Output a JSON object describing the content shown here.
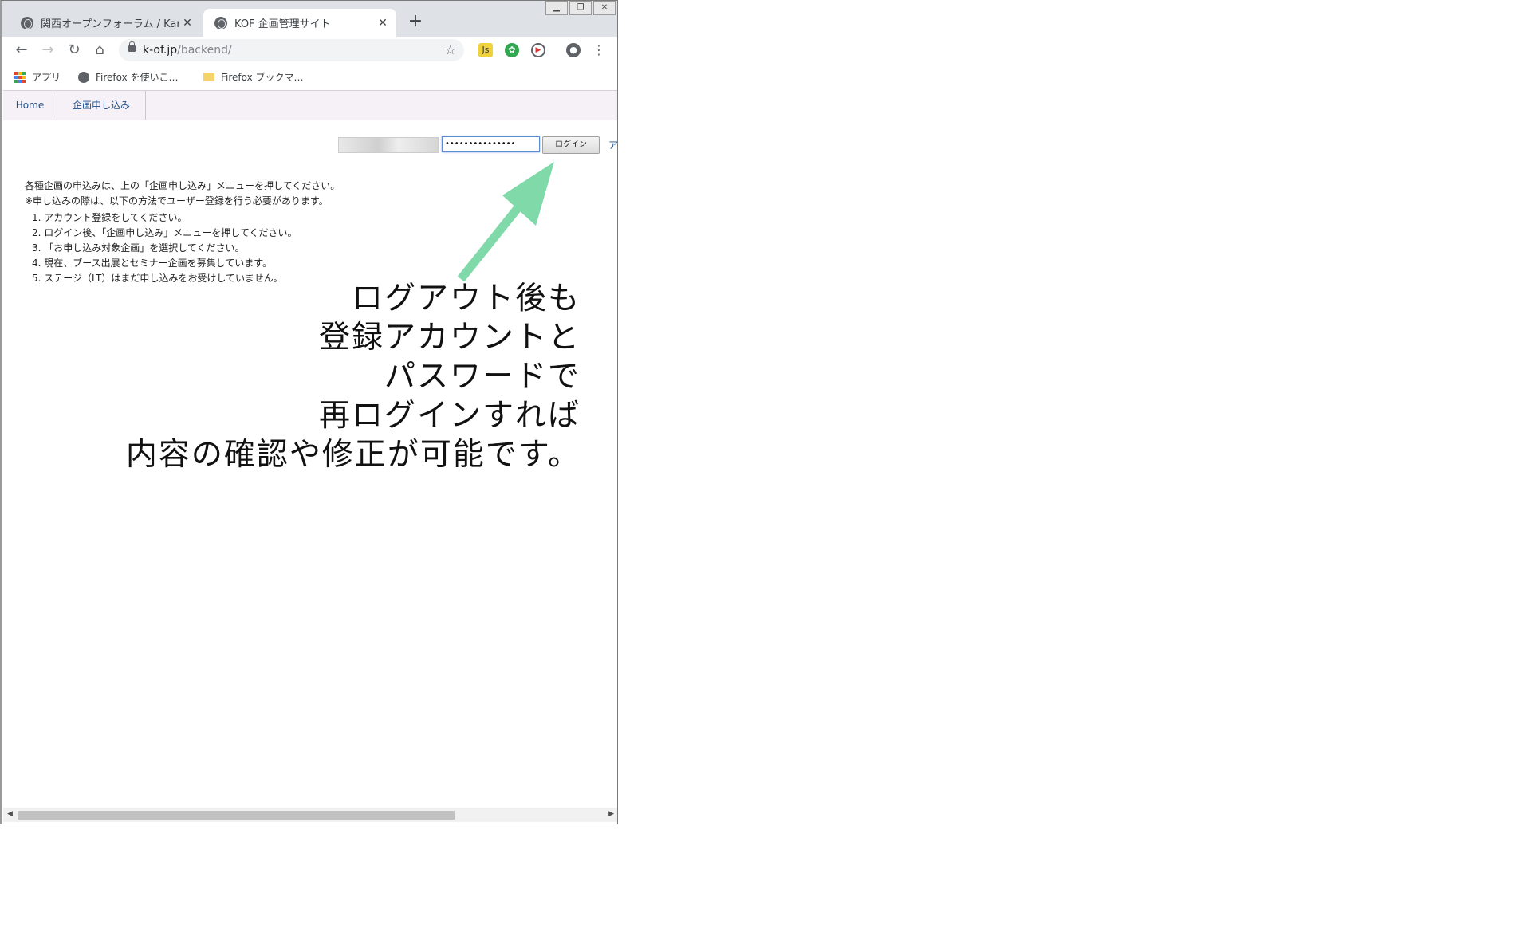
{
  "browser": {
    "tabs": [
      {
        "title": "関西オープンフォーラム / Kansa",
        "active": false
      },
      {
        "title": "KOF 企画管理サイト",
        "active": true
      }
    ],
    "new_tab_symbol": "+",
    "window_controls": [
      "minimize",
      "restore",
      "close"
    ],
    "url_host": "k-of.jp",
    "url_path": "/backend/",
    "bookmarks": [
      {
        "label": "アプリ",
        "icon": "apps-grid-icon"
      },
      {
        "label": "Firefox を使いこ…",
        "icon": "globe-icon"
      },
      {
        "label": "Firefox ブックマ…",
        "icon": "folder-icon"
      }
    ]
  },
  "site_nav": {
    "items": [
      "Home",
      "企画申し込み"
    ]
  },
  "login": {
    "password_mask": "•••••••••••••••",
    "button_label": "ログイン",
    "account_link": "ア"
  },
  "info": {
    "line1": "各種企画の申込みは、上の「企画申し込み」メニューを押してください。",
    "line2": "※申し込みの際は、以下の方法でユーザー登録を行う必要があります。",
    "steps": [
      "1. アカウント登録をしてください。",
      "2. ログイン後、「企画申し込み」メニューを押してください。",
      "3. 「お申し込み対象企画」を選択してください。",
      "4. 現在、ブース出展とセミナー企画を募集しています。",
      "5. ステージ（LT）はまだ申し込みをお受けしていません。"
    ]
  },
  "annotation": {
    "lines": [
      "ログアウト後も",
      "登録アカウントと",
      "パスワードで",
      "再ログインすれば",
      "内容の確認や修正が可能です。"
    ],
    "arrow_color": "#7fd9a8"
  }
}
